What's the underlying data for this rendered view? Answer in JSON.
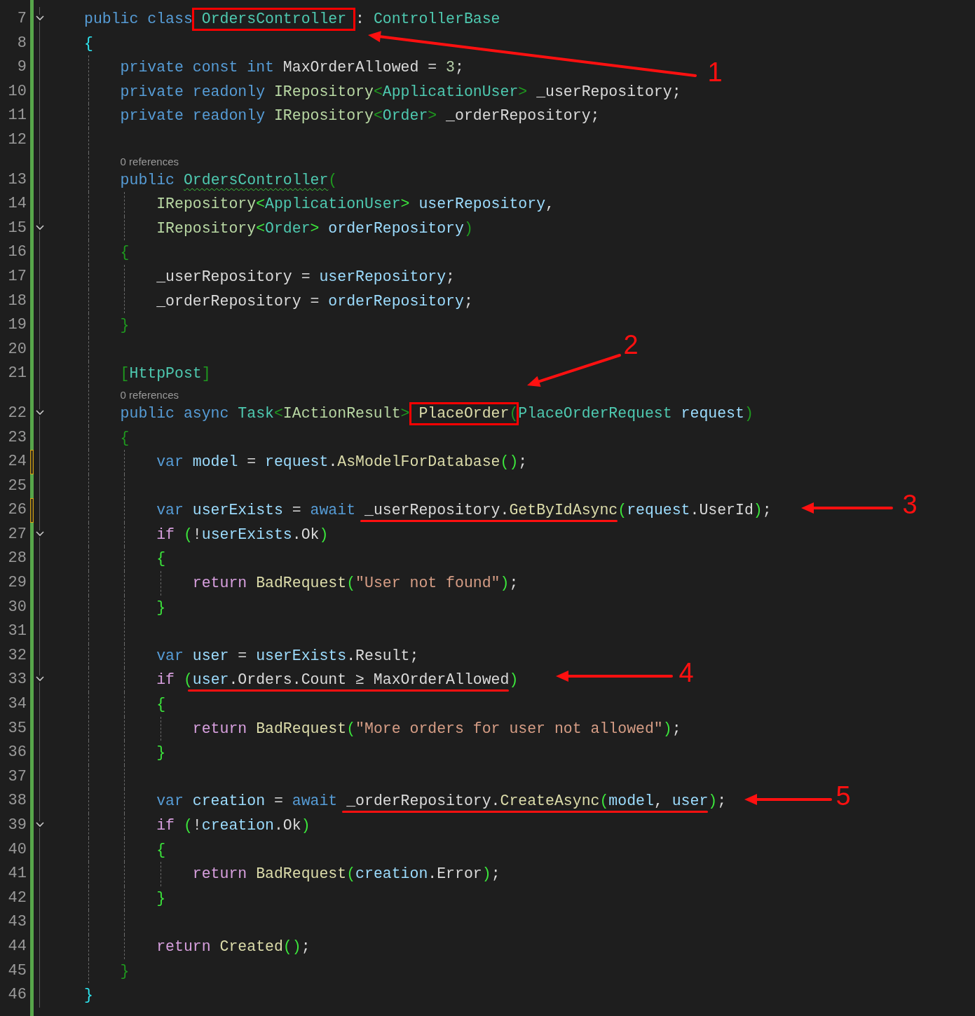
{
  "lines": [
    {
      "kind": "code",
      "number": "7",
      "fold": true,
      "unsaved": false,
      "tokens": [
        {
          "text": "public class ",
          "kind": "kw"
        },
        {
          "text": "OrdersController",
          "kind": "type",
          "boxed": true
        },
        {
          "text": " : ",
          "kind": "plain"
        },
        {
          "text": "ControllerBase",
          "kind": "type"
        }
      ]
    },
    {
      "kind": "code",
      "number": "8",
      "fold": false,
      "unsaved": false,
      "tokens": [
        {
          "text": "{",
          "kind": "b1"
        }
      ],
      "children": [
        {
          "kind": "code",
          "number": "9",
          "fold": false,
          "unsaved": false,
          "tokens": [
            {
              "text": "private const int ",
              "kind": "kw"
            },
            {
              "text": "MaxOrderAllowed = ",
              "kind": "plain"
            },
            {
              "text": "3",
              "kind": "num"
            },
            {
              "text": ";",
              "kind": "plain"
            }
          ]
        },
        {
          "kind": "code",
          "number": "10",
          "fold": false,
          "unsaved": false,
          "tokens": [
            {
              "text": "private readonly ",
              "kind": "kw"
            },
            {
              "text": "IRepository",
              "kind": "iface"
            },
            {
              "text": "<",
              "kind": "b3"
            },
            {
              "text": "ApplicationUser",
              "kind": "type"
            },
            {
              "text": ">",
              "kind": "b3"
            },
            {
              "text": " _userRepository;",
              "kind": "plain"
            }
          ]
        },
        {
          "kind": "code",
          "number": "11",
          "fold": false,
          "unsaved": false,
          "tokens": [
            {
              "text": "private readonly ",
              "kind": "kw"
            },
            {
              "text": "IRepository",
              "kind": "iface"
            },
            {
              "text": "<",
              "kind": "b3"
            },
            {
              "text": "Order",
              "kind": "type"
            },
            {
              "text": ">",
              "kind": "b3"
            },
            {
              "text": " _orderRepository;",
              "kind": "plain"
            }
          ]
        },
        {
          "kind": "code",
          "number": "12",
          "fold": false,
          "unsaved": false
        },
        {
          "kind": "codelens",
          "text": "0 references"
        },
        {
          "kind": "code",
          "number": "13",
          "fold": false,
          "unsaved": false,
          "tokens": [
            {
              "text": "public ",
              "kind": "kw"
            },
            {
              "text": "OrdersController",
              "kind": "type",
              "squiggly": true
            },
            {
              "text": "(",
              "kind": "b3"
            }
          ],
          "children": [
            {
              "kind": "code",
              "number": "14",
              "fold": false,
              "unsaved": false,
              "tokens": [
                {
                  "text": "IRepository",
                  "kind": "iface"
                },
                {
                  "text": "<",
                  "kind": "b2"
                },
                {
                  "text": "ApplicationUser",
                  "kind": "type"
                },
                {
                  "text": ">",
                  "kind": "b2"
                },
                {
                  "text": " userRepository",
                  "kind": "var"
                },
                {
                  "text": ",",
                  "kind": "plain"
                }
              ]
            },
            {
              "kind": "code",
              "number": "15",
              "fold": true,
              "unsaved": false,
              "tokens": [
                {
                  "text": "IRepository",
                  "kind": "iface"
                },
                {
                  "text": "<",
                  "kind": "b2"
                },
                {
                  "text": "Order",
                  "kind": "type"
                },
                {
                  "text": ">",
                  "kind": "b2"
                },
                {
                  "text": " orderRepository",
                  "kind": "var"
                },
                {
                  "text": ")",
                  "kind": "b3"
                }
              ]
            }
          ]
        },
        {
          "kind": "code",
          "number": "16",
          "fold": false,
          "unsaved": false,
          "tokens": [
            {
              "text": "{",
              "kind": "b3"
            }
          ],
          "children": [
            {
              "kind": "code",
              "number": "17",
              "fold": false,
              "unsaved": false,
              "tokens": [
                {
                  "text": "_userRepository = ",
                  "kind": "plain"
                },
                {
                  "text": "userRepository",
                  "kind": "var"
                },
                {
                  "text": ";",
                  "kind": "plain"
                }
              ]
            },
            {
              "kind": "code",
              "number": "18",
              "fold": false,
              "unsaved": false,
              "tokens": [
                {
                  "text": "_orderRepository = ",
                  "kind": "plain"
                },
                {
                  "text": "orderRepository",
                  "kind": "var"
                },
                {
                  "text": ";",
                  "kind": "plain"
                }
              ]
            }
          ]
        },
        {
          "kind": "code",
          "number": "19",
          "fold": false,
          "unsaved": false,
          "tokens": [
            {
              "text": "}",
              "kind": "b3"
            }
          ]
        },
        {
          "kind": "code",
          "number": "20",
          "fold": false,
          "unsaved": false
        },
        {
          "kind": "code",
          "number": "21",
          "fold": false,
          "unsaved": false,
          "tokens": [
            {
              "text": "[",
              "kind": "b3"
            },
            {
              "text": "HttpPost",
              "kind": "type"
            },
            {
              "text": "]",
              "kind": "b3"
            }
          ]
        },
        {
          "kind": "codelens",
          "text": "0 references"
        },
        {
          "kind": "code",
          "number": "22",
          "fold": true,
          "unsaved": false,
          "tokens": [
            {
              "text": "public async ",
              "kind": "kw"
            },
            {
              "text": "Task",
              "kind": "type"
            },
            {
              "text": "<",
              "kind": "b3"
            },
            {
              "text": "IActionResult",
              "kind": "iface"
            },
            {
              "text": "> ",
              "kind": "b3"
            },
            {
              "text": "PlaceOrder",
              "kind": "method",
              "boxed": true
            },
            {
              "text": "(",
              "kind": "b3"
            },
            {
              "text": "PlaceOrderRequest",
              "kind": "type"
            },
            {
              "text": " request",
              "kind": "var"
            },
            {
              "text": ")",
              "kind": "b3"
            }
          ]
        },
        {
          "kind": "code",
          "number": "23",
          "fold": false,
          "unsaved": false,
          "tokens": [
            {
              "text": "{",
              "kind": "b3"
            }
          ],
          "children": [
            {
              "kind": "code",
              "number": "24",
              "fold": false,
              "unsaved": true,
              "tokens": [
                {
                  "text": "var ",
                  "kind": "kw"
                },
                {
                  "text": "model",
                  "kind": "var"
                },
                {
                  "text": " = ",
                  "kind": "plain"
                },
                {
                  "text": "request",
                  "kind": "var"
                },
                {
                  "text": ".",
                  "kind": "plain"
                },
                {
                  "text": "AsModelForDatabase",
                  "kind": "method"
                },
                {
                  "text": "()",
                  "kind": "b2"
                },
                {
                  "text": ";",
                  "kind": "plain"
                }
              ]
            },
            {
              "kind": "code",
              "number": "25",
              "fold": false,
              "unsaved": false
            },
            {
              "kind": "code",
              "number": "26",
              "fold": false,
              "unsaved": true,
              "tokens": [
                {
                  "text": "var ",
                  "kind": "kw"
                },
                {
                  "text": "userExists",
                  "kind": "var"
                },
                {
                  "text": " = ",
                  "kind": "plain"
                },
                {
                  "text": "await ",
                  "kind": "kw"
                },
                {
                  "text": "_userRepository",
                  "kind": "plain",
                  "underlined": true
                },
                {
                  "text": ".",
                  "kind": "plain",
                  "underlined": true
                },
                {
                  "text": "GetByIdAsync",
                  "kind": "method",
                  "underlined": true
                },
                {
                  "text": "(",
                  "kind": "b2"
                },
                {
                  "text": "request",
                  "kind": "var"
                },
                {
                  "text": ".UserId",
                  "kind": "plain"
                },
                {
                  "text": ")",
                  "kind": "b2"
                },
                {
                  "text": ";",
                  "kind": "plain"
                }
              ]
            },
            {
              "kind": "code",
              "number": "27",
              "fold": true,
              "unsaved": false,
              "tokens": [
                {
                  "text": "if ",
                  "kind": "ctl"
                },
                {
                  "text": "(",
                  "kind": "b2"
                },
                {
                  "text": "!",
                  "kind": "plain"
                },
                {
                  "text": "userExists",
                  "kind": "var"
                },
                {
                  "text": ".Ok",
                  "kind": "plain"
                },
                {
                  "text": ")",
                  "kind": "b2"
                }
              ]
            },
            {
              "kind": "code",
              "number": "28",
              "fold": false,
              "unsaved": false,
              "tokens": [
                {
                  "text": "{",
                  "kind": "b2"
                }
              ],
              "children": [
                {
                  "kind": "code",
                  "number": "29",
                  "fold": false,
                  "unsaved": false,
                  "tokens": [
                    {
                      "text": "return ",
                      "kind": "ctl"
                    },
                    {
                      "text": "BadRequest",
                      "kind": "method"
                    },
                    {
                      "text": "(",
                      "kind": "b2"
                    },
                    {
                      "text": "\"User not found\"",
                      "kind": "str"
                    },
                    {
                      "text": ")",
                      "kind": "b2"
                    },
                    {
                      "text": ";",
                      "kind": "plain"
                    }
                  ]
                }
              ]
            },
            {
              "kind": "code",
              "number": "30",
              "fold": false,
              "unsaved": false,
              "tokens": [
                {
                  "text": "}",
                  "kind": "b2"
                }
              ]
            },
            {
              "kind": "code",
              "number": "31",
              "fold": false,
              "unsaved": false
            },
            {
              "kind": "code",
              "number": "32",
              "fold": false,
              "unsaved": false,
              "tokens": [
                {
                  "text": "var ",
                  "kind": "kw"
                },
                {
                  "text": "user",
                  "kind": "var"
                },
                {
                  "text": " = ",
                  "kind": "plain"
                },
                {
                  "text": "userExists",
                  "kind": "var"
                },
                {
                  "text": ".Result;",
                  "kind": "plain"
                }
              ]
            },
            {
              "kind": "code",
              "number": "33",
              "fold": true,
              "unsaved": false,
              "tokens": [
                {
                  "text": "if ",
                  "kind": "ctl"
                },
                {
                  "text": "(",
                  "kind": "b2"
                },
                {
                  "text": "user",
                  "kind": "var",
                  "underlined": true
                },
                {
                  "text": ".Orders.Count ≥ MaxOrderAllowed",
                  "kind": "plain",
                  "underlined": true
                },
                {
                  "text": ")",
                  "kind": "b2"
                }
              ]
            },
            {
              "kind": "code",
              "number": "34",
              "fold": false,
              "unsaved": false,
              "tokens": [
                {
                  "text": "{",
                  "kind": "b2"
                }
              ],
              "children": [
                {
                  "kind": "code",
                  "number": "35",
                  "fold": false,
                  "unsaved": false,
                  "tokens": [
                    {
                      "text": "return ",
                      "kind": "ctl"
                    },
                    {
                      "text": "BadRequest",
                      "kind": "method"
                    },
                    {
                      "text": "(",
                      "kind": "b2"
                    },
                    {
                      "text": "\"More orders for user not allowed\"",
                      "kind": "str"
                    },
                    {
                      "text": ")",
                      "kind": "b2"
                    },
                    {
                      "text": ";",
                      "kind": "plain"
                    }
                  ]
                }
              ]
            },
            {
              "kind": "code",
              "number": "36",
              "fold": false,
              "unsaved": false,
              "tokens": [
                {
                  "text": "}",
                  "kind": "b2"
                }
              ]
            },
            {
              "kind": "code",
              "number": "37",
              "fold": false,
              "unsaved": false
            },
            {
              "kind": "code",
              "number": "38",
              "fold": false,
              "unsaved": false,
              "tokens": [
                {
                  "text": "var ",
                  "kind": "kw"
                },
                {
                  "text": "creation",
                  "kind": "var"
                },
                {
                  "text": " = ",
                  "kind": "plain"
                },
                {
                  "text": "await ",
                  "kind": "kw"
                },
                {
                  "text": "_orderRepository.",
                  "kind": "plain",
                  "underlined": true
                },
                {
                  "text": "CreateAsync",
                  "kind": "method",
                  "underlined": true
                },
                {
                  "text": "(",
                  "kind": "b2",
                  "underlined": true
                },
                {
                  "text": "model",
                  "kind": "var",
                  "underlined": true
                },
                {
                  "text": ", ",
                  "kind": "plain",
                  "underlined": true
                },
                {
                  "text": "user",
                  "kind": "var",
                  "underlined": true
                },
                {
                  "text": ")",
                  "kind": "b2"
                },
                {
                  "text": ";",
                  "kind": "plain"
                }
              ]
            },
            {
              "kind": "code",
              "number": "39",
              "fold": true,
              "unsaved": false,
              "tokens": [
                {
                  "text": "if ",
                  "kind": "ctl"
                },
                {
                  "text": "(",
                  "kind": "b2"
                },
                {
                  "text": "!",
                  "kind": "plain"
                },
                {
                  "text": "creation",
                  "kind": "var"
                },
                {
                  "text": ".Ok",
                  "kind": "plain"
                },
                {
                  "text": ")",
                  "kind": "b2"
                }
              ]
            },
            {
              "kind": "code",
              "number": "40",
              "fold": false,
              "unsaved": false,
              "tokens": [
                {
                  "text": "{",
                  "kind": "b2"
                }
              ],
              "children": [
                {
                  "kind": "code",
                  "number": "41",
                  "fold": false,
                  "unsaved": false,
                  "tokens": [
                    {
                      "text": "return ",
                      "kind": "ctl"
                    },
                    {
                      "text": "BadRequest",
                      "kind": "method"
                    },
                    {
                      "text": "(",
                      "kind": "b2"
                    },
                    {
                      "text": "creation",
                      "kind": "var"
                    },
                    {
                      "text": ".Error",
                      "kind": "plain"
                    },
                    {
                      "text": ")",
                      "kind": "b2"
                    },
                    {
                      "text": ";",
                      "kind": "plain"
                    }
                  ]
                }
              ]
            },
            {
              "kind": "code",
              "number": "42",
              "fold": false,
              "unsaved": false,
              "tokens": [
                {
                  "text": "}",
                  "kind": "b2"
                }
              ]
            },
            {
              "kind": "code",
              "number": "43",
              "fold": false,
              "unsaved": false
            },
            {
              "kind": "code",
              "number": "44",
              "fold": false,
              "unsaved": false,
              "tokens": [
                {
                  "text": "return ",
                  "kind": "ctl"
                },
                {
                  "text": "Created",
                  "kind": "method"
                },
                {
                  "text": "()",
                  "kind": "b2"
                },
                {
                  "text": ";",
                  "kind": "plain"
                }
              ]
            }
          ]
        },
        {
          "kind": "code",
          "number": "45",
          "fold": false,
          "unsaved": false,
          "tokens": [
            {
              "text": "}",
              "kind": "b3"
            }
          ]
        }
      ]
    },
    {
      "kind": "code",
      "number": "46",
      "fold": false,
      "unsaved": false,
      "tokens": [
        {
          "text": "}",
          "kind": "b1"
        }
      ]
    }
  ],
  "callouts": [
    {
      "label": "1"
    },
    {
      "label": "2"
    },
    {
      "label": "3"
    },
    {
      "label": "4"
    },
    {
      "label": "5"
    }
  ]
}
